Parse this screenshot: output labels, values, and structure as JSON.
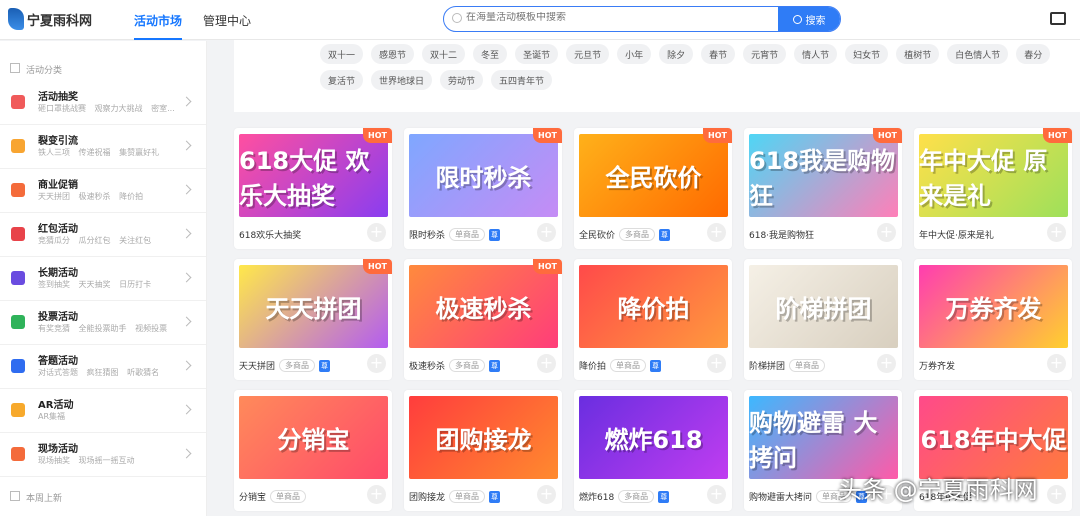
{
  "header": {
    "logo": "宁夏雨科网",
    "nav": [
      "活动市场",
      "管理中心"
    ],
    "search_placeholder": "在海量活动模板中搜索",
    "search_button": "搜索"
  },
  "sidebar": {
    "heading": "活动分类",
    "items": [
      {
        "title": "活动抽奖",
        "sub": "砸口罩挑战赛 观察力大挑战 密室...",
        "color": "#f05a5a"
      },
      {
        "title": "裂变引流",
        "sub": "铁人三项 传递祝福 集赞赢好礼",
        "color": "#f8a531"
      },
      {
        "title": "商业促销",
        "sub": "天天拼团 极速秒杀 降价拍",
        "color": "#f46b3b"
      },
      {
        "title": "红包活动",
        "sub": "竞猜瓜分 瓜分红包 关注红包",
        "color": "#e8434a"
      },
      {
        "title": "长期活动",
        "sub": "签到抽奖 天天抽奖 日历打卡",
        "color": "#6a4ce0"
      },
      {
        "title": "投票活动",
        "sub": "有奖竞猜 全能投票助手 视频投票",
        "color": "#2fb35a"
      },
      {
        "title": "答题活动",
        "sub": "对话式答题 疯狂猜图 听歌猜名",
        "color": "#2f6cf0"
      },
      {
        "title": "AR活动",
        "sub": "AR集福",
        "color": "#f7a92c"
      },
      {
        "title": "现场活动",
        "sub": "现场抽奖 现场摇一摇互动",
        "color": "#f46b3b"
      }
    ],
    "footer": "本周上新"
  },
  "holiday_tags": [
    "双十一",
    "感恩节",
    "双十二",
    "冬至",
    "圣诞节",
    "元旦节",
    "小年",
    "除夕",
    "春节",
    "元宵节",
    "情人节",
    "妇女节",
    "植树节",
    "白色情人节",
    "春分",
    "复活节",
    "世界地球日",
    "劳动节",
    "五四青年节"
  ],
  "hot_label": "HOT",
  "premium_label": "尊",
  "cards": [
    {
      "name": "618欢乐大抽奖",
      "banner": "618大促 欢乐大抽奖",
      "hot": true,
      "type": "",
      "premium": false,
      "bg": "linear-gradient(135deg,#ff4fa0,#8a3df0)"
    },
    {
      "name": "限时秒杀",
      "banner": "限时秒杀",
      "hot": true,
      "type": "单商品",
      "premium": true,
      "bg": "linear-gradient(135deg,#7fa7ff,#c58cf5)"
    },
    {
      "name": "全民砍价",
      "banner": "全民砍价",
      "hot": true,
      "type": "多商品",
      "premium": true,
      "bg": "linear-gradient(135deg,#ffb11a,#ff6a00)"
    },
    {
      "name": "618·我是购物狂",
      "banner": "618我是购物狂",
      "hot": true,
      "type": "",
      "premium": false,
      "bg": "linear-gradient(135deg,#4fd6f5,#ff7fb8)"
    },
    {
      "name": "年中大促·原来是礼",
      "banner": "年中大促 原来是礼",
      "hot": true,
      "type": "",
      "premium": false,
      "bg": "linear-gradient(135deg,#ffe04a,#9ee05a)"
    },
    {
      "name": "天天拼团",
      "banner": "天天拼团",
      "hot": true,
      "type": "多商品",
      "premium": true,
      "bg": "linear-gradient(135deg,#ffe84a,#b35cf0)"
    },
    {
      "name": "极速秒杀",
      "banner": "极速秒杀",
      "hot": true,
      "type": "多商品",
      "premium": true,
      "bg": "linear-gradient(135deg,#ff8a3d,#ff3d7a)"
    },
    {
      "name": "降价拍",
      "banner": "降价拍",
      "hot": false,
      "type": "单商品",
      "premium": true,
      "bg": "linear-gradient(135deg,#ff4a4a,#ff9a3d)"
    },
    {
      "name": "阶梯拼团",
      "banner": "阶梯拼团",
      "hot": false,
      "type": "单商品",
      "premium": false,
      "bg": "linear-gradient(135deg,#f5f0e6,#d8cfbf)"
    },
    {
      "name": "万券齐发",
      "banner": "万券齐发",
      "hot": false,
      "type": "",
      "premium": false,
      "bg": "linear-gradient(135deg,#ff3db0,#ffd02e)"
    },
    {
      "name": "分销宝",
      "banner": "分销宝",
      "hot": false,
      "type": "单商品",
      "premium": false,
      "bg": "linear-gradient(135deg,#ff8a5a,#ff4a6a)"
    },
    {
      "name": "团购接龙",
      "banner": "团购接龙",
      "hot": false,
      "type": "单商品",
      "premium": true,
      "bg": "linear-gradient(135deg,#ff3d3d,#ff8a2e)"
    },
    {
      "name": "燃炸618",
      "banner": "燃炸618",
      "hot": false,
      "type": "多商品",
      "premium": true,
      "bg": "linear-gradient(135deg,#6a2ee0,#c03df0)"
    },
    {
      "name": "购物避雷大拷问",
      "banner": "购物避雷 大拷问",
      "hot": false,
      "type": "单商品",
      "premium": true,
      "bg": "linear-gradient(135deg,#3db8ff,#ff5aa8)"
    },
    {
      "name": "618年中大促",
      "banner": "618年中大促",
      "hot": false,
      "type": "",
      "premium": false,
      "bg": "linear-gradient(135deg,#ff4a8a,#ff7a3d)"
    }
  ],
  "watermark": "头条 @宁夏雨科网"
}
